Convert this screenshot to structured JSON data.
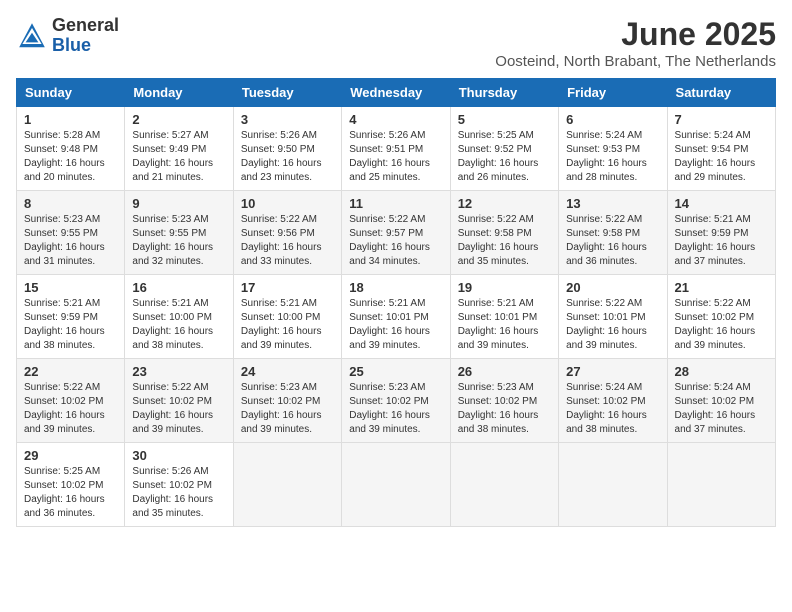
{
  "logo": {
    "general": "General",
    "blue": "Blue"
  },
  "title": "June 2025",
  "location": "Oosteind, North Brabant, The Netherlands",
  "days_of_week": [
    "Sunday",
    "Monday",
    "Tuesday",
    "Wednesday",
    "Thursday",
    "Friday",
    "Saturday"
  ],
  "weeks": [
    [
      {
        "day": "1",
        "sunrise": "5:28 AM",
        "sunset": "9:48 PM",
        "daylight": "16 hours and 20 minutes."
      },
      {
        "day": "2",
        "sunrise": "5:27 AM",
        "sunset": "9:49 PM",
        "daylight": "16 hours and 21 minutes."
      },
      {
        "day": "3",
        "sunrise": "5:26 AM",
        "sunset": "9:50 PM",
        "daylight": "16 hours and 23 minutes."
      },
      {
        "day": "4",
        "sunrise": "5:26 AM",
        "sunset": "9:51 PM",
        "daylight": "16 hours and 25 minutes."
      },
      {
        "day": "5",
        "sunrise": "5:25 AM",
        "sunset": "9:52 PM",
        "daylight": "16 hours and 26 minutes."
      },
      {
        "day": "6",
        "sunrise": "5:24 AM",
        "sunset": "9:53 PM",
        "daylight": "16 hours and 28 minutes."
      },
      {
        "day": "7",
        "sunrise": "5:24 AM",
        "sunset": "9:54 PM",
        "daylight": "16 hours and 29 minutes."
      }
    ],
    [
      {
        "day": "8",
        "sunrise": "5:23 AM",
        "sunset": "9:55 PM",
        "daylight": "16 hours and 31 minutes."
      },
      {
        "day": "9",
        "sunrise": "5:23 AM",
        "sunset": "9:55 PM",
        "daylight": "16 hours and 32 minutes."
      },
      {
        "day": "10",
        "sunrise": "5:22 AM",
        "sunset": "9:56 PM",
        "daylight": "16 hours and 33 minutes."
      },
      {
        "day": "11",
        "sunrise": "5:22 AM",
        "sunset": "9:57 PM",
        "daylight": "16 hours and 34 minutes."
      },
      {
        "day": "12",
        "sunrise": "5:22 AM",
        "sunset": "9:58 PM",
        "daylight": "16 hours and 35 minutes."
      },
      {
        "day": "13",
        "sunrise": "5:22 AM",
        "sunset": "9:58 PM",
        "daylight": "16 hours and 36 minutes."
      },
      {
        "day": "14",
        "sunrise": "5:21 AM",
        "sunset": "9:59 PM",
        "daylight": "16 hours and 37 minutes."
      }
    ],
    [
      {
        "day": "15",
        "sunrise": "5:21 AM",
        "sunset": "9:59 PM",
        "daylight": "16 hours and 38 minutes."
      },
      {
        "day": "16",
        "sunrise": "5:21 AM",
        "sunset": "10:00 PM",
        "daylight": "16 hours and 38 minutes."
      },
      {
        "day": "17",
        "sunrise": "5:21 AM",
        "sunset": "10:00 PM",
        "daylight": "16 hours and 39 minutes."
      },
      {
        "day": "18",
        "sunrise": "5:21 AM",
        "sunset": "10:01 PM",
        "daylight": "16 hours and 39 minutes."
      },
      {
        "day": "19",
        "sunrise": "5:21 AM",
        "sunset": "10:01 PM",
        "daylight": "16 hours and 39 minutes."
      },
      {
        "day": "20",
        "sunrise": "5:22 AM",
        "sunset": "10:01 PM",
        "daylight": "16 hours and 39 minutes."
      },
      {
        "day": "21",
        "sunrise": "5:22 AM",
        "sunset": "10:02 PM",
        "daylight": "16 hours and 39 minutes."
      }
    ],
    [
      {
        "day": "22",
        "sunrise": "5:22 AM",
        "sunset": "10:02 PM",
        "daylight": "16 hours and 39 minutes."
      },
      {
        "day": "23",
        "sunrise": "5:22 AM",
        "sunset": "10:02 PM",
        "daylight": "16 hours and 39 minutes."
      },
      {
        "day": "24",
        "sunrise": "5:23 AM",
        "sunset": "10:02 PM",
        "daylight": "16 hours and 39 minutes."
      },
      {
        "day": "25",
        "sunrise": "5:23 AM",
        "sunset": "10:02 PM",
        "daylight": "16 hours and 39 minutes."
      },
      {
        "day": "26",
        "sunrise": "5:23 AM",
        "sunset": "10:02 PM",
        "daylight": "16 hours and 38 minutes."
      },
      {
        "day": "27",
        "sunrise": "5:24 AM",
        "sunset": "10:02 PM",
        "daylight": "16 hours and 38 minutes."
      },
      {
        "day": "28",
        "sunrise": "5:24 AM",
        "sunset": "10:02 PM",
        "daylight": "16 hours and 37 minutes."
      }
    ],
    [
      {
        "day": "29",
        "sunrise": "5:25 AM",
        "sunset": "10:02 PM",
        "daylight": "16 hours and 36 minutes."
      },
      {
        "day": "30",
        "sunrise": "5:26 AM",
        "sunset": "10:02 PM",
        "daylight": "16 hours and 35 minutes."
      },
      null,
      null,
      null,
      null,
      null
    ]
  ]
}
